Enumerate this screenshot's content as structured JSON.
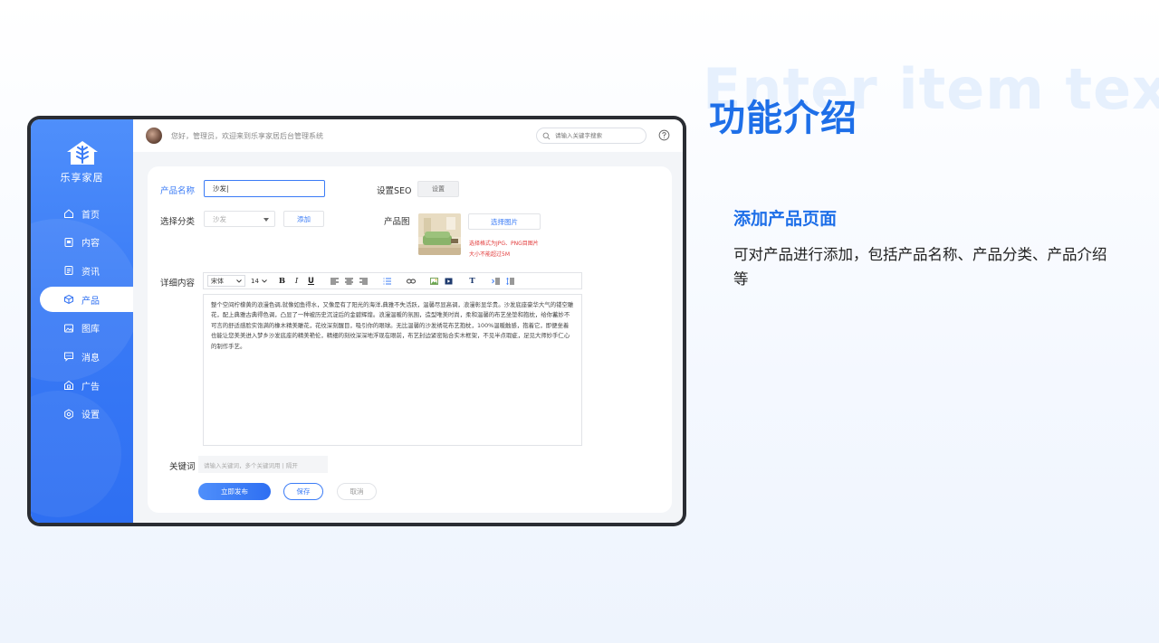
{
  "slide": {
    "watermark": "Enter item text",
    "title": "功能介绍",
    "section_title": "添加产品页面",
    "section_desc": "可对产品进行添加，包括产品名称、产品分类、产品介绍等"
  },
  "app": {
    "logo_text": "乐享家居",
    "menu": [
      {
        "label": "首页",
        "icon": "home-icon",
        "active": false
      },
      {
        "label": "内容",
        "icon": "content-icon",
        "active": false
      },
      {
        "label": "资讯",
        "icon": "news-icon",
        "active": false
      },
      {
        "label": "产品",
        "icon": "product-icon",
        "active": true
      },
      {
        "label": "图库",
        "icon": "gallery-icon",
        "active": false
      },
      {
        "label": "消息",
        "icon": "message-icon",
        "active": false
      },
      {
        "label": "广告",
        "icon": "ad-icon",
        "active": false
      },
      {
        "label": "设置",
        "icon": "settings-icon",
        "active": false
      }
    ],
    "topbar": {
      "welcome": "您好，管理员，欢迎来到乐享家居后台管理系统",
      "search_placeholder": "请输入关键字搜索"
    },
    "form": {
      "name_label": "产品名称",
      "name_value": "沙发|",
      "seo_label": "设置SEO",
      "seo_button": "设置",
      "category_label": "选择分类",
      "category_value": "沙发",
      "add_button": "添加",
      "image_label": "产品图",
      "choose_image_button": "选择图片",
      "image_hint_1": "选择格式为JPG、PNG目图片",
      "image_hint_2": "大小不能超过5M",
      "detail_label": "详细内容",
      "toolbar": {
        "font": "宋体",
        "size": "14",
        "bold": "B",
        "italic": "I",
        "underline": "U",
        "text": "T"
      },
      "detail_text": "整个空间柠檬黄的浪漫色调,就像如鱼得水，又像是有了阳光的海洋,典雅不失活跃，温馨尽显高调，浪漫彰显华贵。沙发底座豪华大气的镂空雕花，配上典雅古典得色调，凸显了一种被历史沉淀后的金碧辉煌。浪漫温暖的氛围，造型唯美时尚，柔和温馨的布艺坐垫和抱枕，给你蓄妙不可言的舒适感脸实饱满的橡木精美雕花，花纹深刻醒目，吸引你的眼球。无比温馨的沙发绣花布艺抱枕，100%温暖触感，抱着它，即便坐着也能让您美美进入梦乡沙发底座的精美艳伦，精细的刻纹深深地浮现在眼前，布艺封边紧密贴合实木框架，不见半点瑕疵，足见大师妙手仁心的制作手艺。",
      "keyword_label": "关键词",
      "keyword_placeholder": "请输入关键词，多个关键词用 | 隔开",
      "publish_button": "立即发布",
      "save_button": "保存",
      "cancel_button": "取消"
    }
  }
}
